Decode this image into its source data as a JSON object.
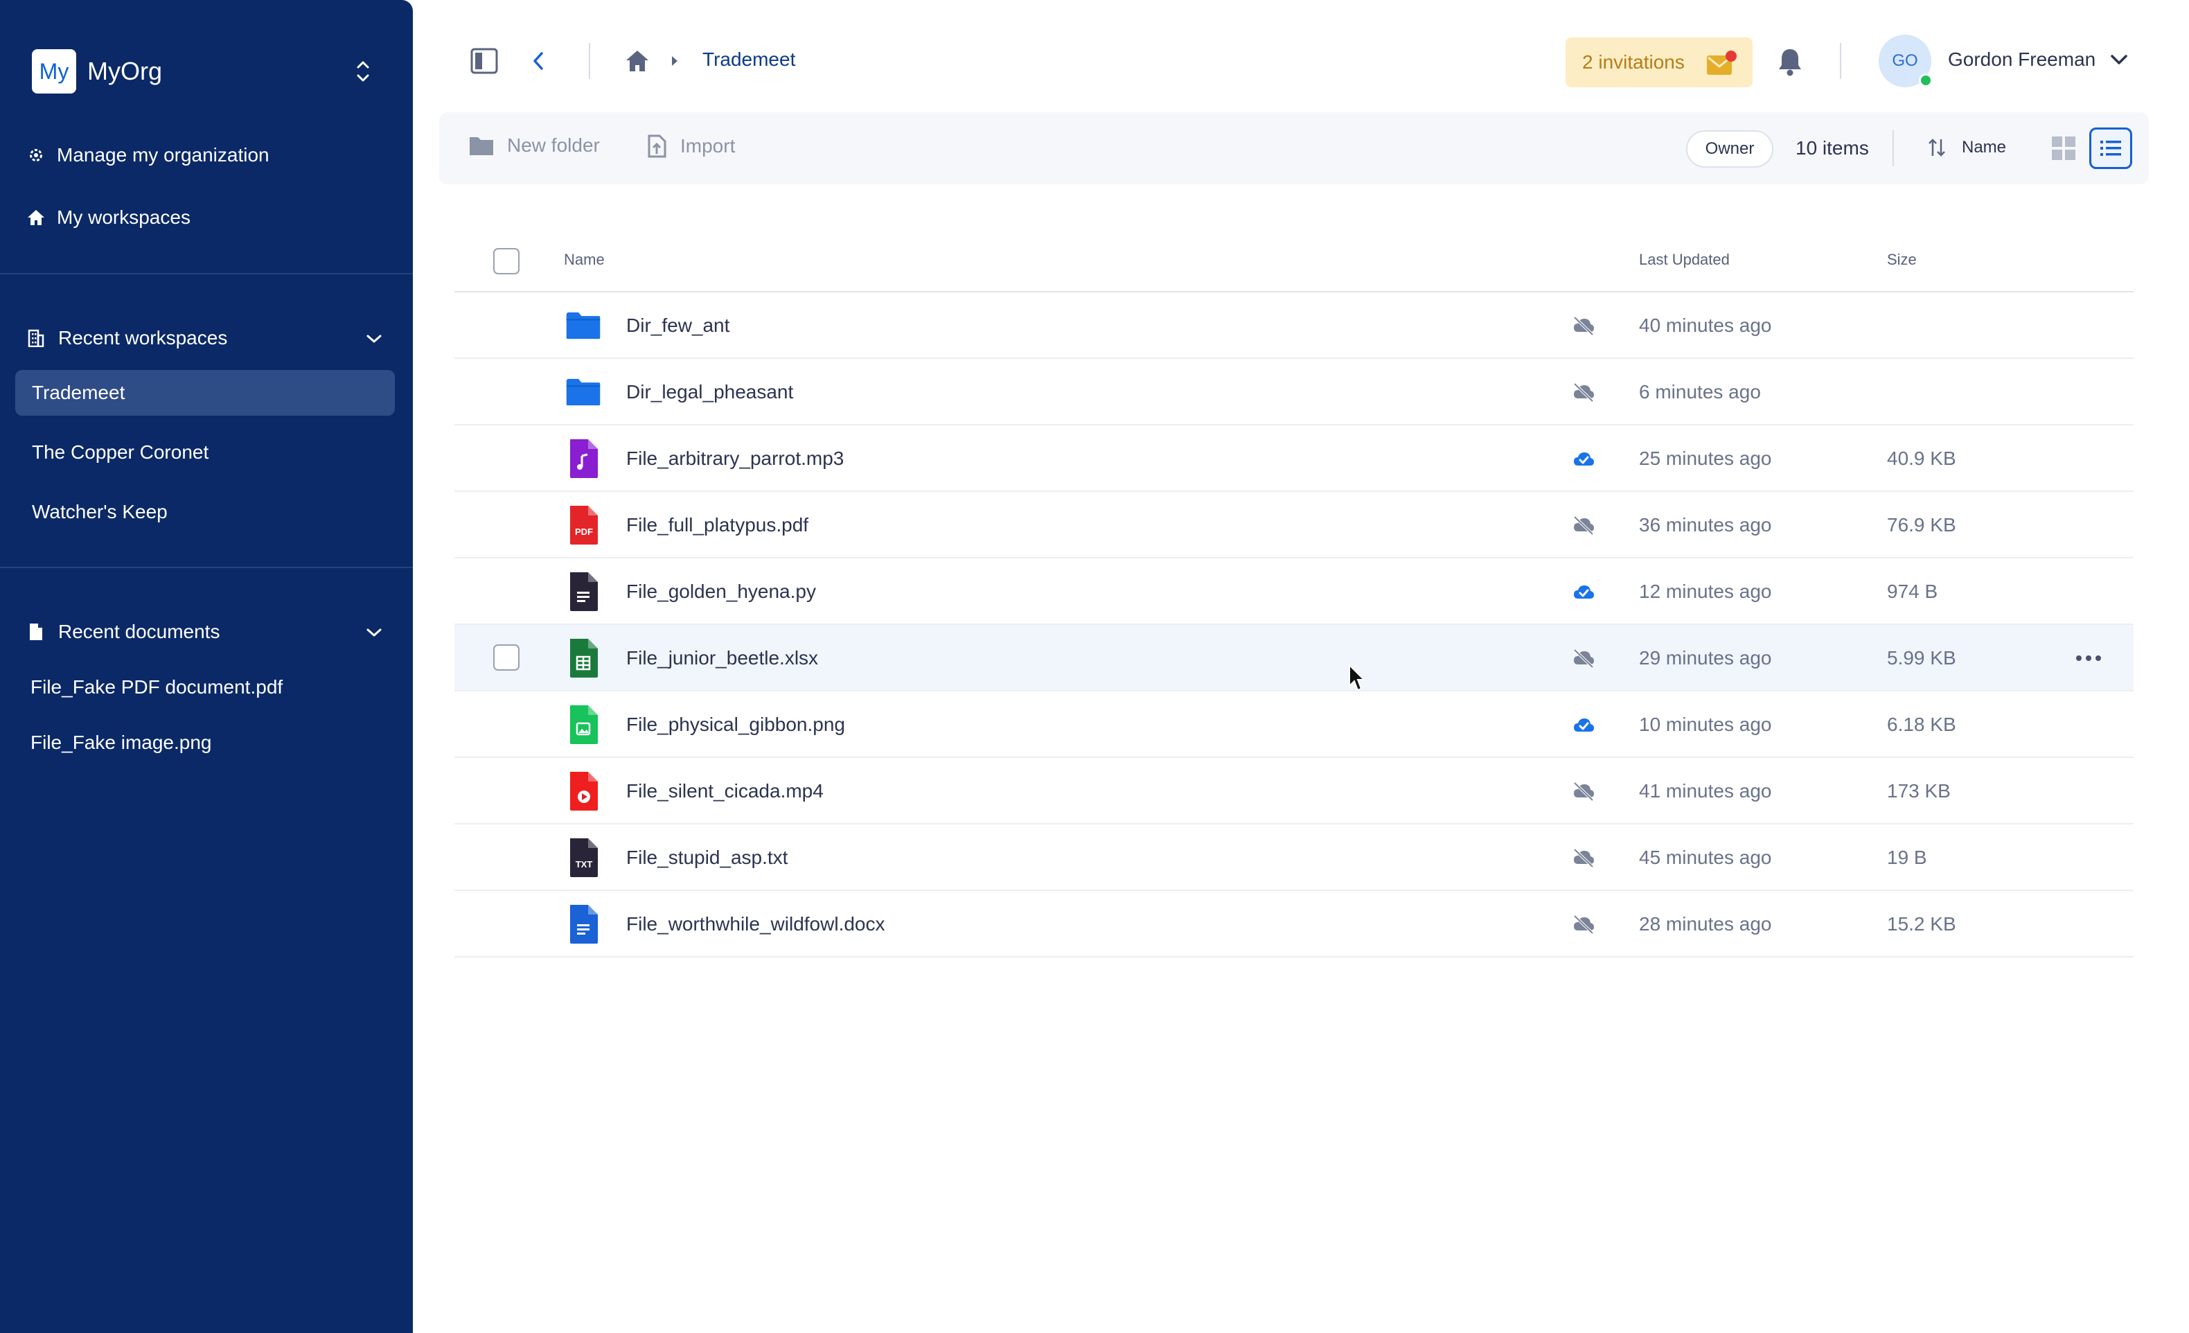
{
  "sidebar": {
    "org_logo": "My",
    "org_name": "MyOrg",
    "nav": [
      {
        "label": "Manage my organization",
        "icon": "gear-icon"
      },
      {
        "label": "My workspaces",
        "icon": "home-icon"
      }
    ],
    "recent_workspaces": {
      "title": "Recent workspaces",
      "items": [
        "Trademeet",
        "The Copper Coronet",
        "Watcher's Keep"
      ],
      "active": "Trademeet"
    },
    "recent_documents": {
      "title": "Recent documents",
      "items": [
        "File_Fake PDF document.pdf",
        "File_Fake image.png"
      ]
    }
  },
  "topbar": {
    "breadcrumb_current": "Trademeet",
    "invitations_label": "2 invitations",
    "user_initials": "GO",
    "user_name": "Gordon Freeman"
  },
  "toolbar": {
    "new_folder_label": "New folder",
    "import_label": "Import",
    "owner_label": "Owner",
    "items_count": "10 items",
    "sort_label": "Name"
  },
  "table": {
    "columns": {
      "name": "Name",
      "last_updated": "Last Updated",
      "size": "Size"
    },
    "rows": [
      {
        "name": "Dir_few_ant",
        "type": "folder",
        "synced": false,
        "updated": "40 minutes ago",
        "size": ""
      },
      {
        "name": "Dir_legal_pheasant",
        "type": "folder",
        "synced": false,
        "updated": "6 minutes ago",
        "size": ""
      },
      {
        "name": "File_arbitrary_parrot.mp3",
        "type": "audio",
        "synced": true,
        "updated": "25 minutes ago",
        "size": "40.9 KB"
      },
      {
        "name": "File_full_platypus.pdf",
        "type": "pdf",
        "synced": false,
        "updated": "36 minutes ago",
        "size": "76.9 KB"
      },
      {
        "name": "File_golden_hyena.py",
        "type": "code",
        "synced": true,
        "updated": "12 minutes ago",
        "size": "974 B"
      },
      {
        "name": "File_junior_beetle.xlsx",
        "type": "sheet",
        "synced": false,
        "updated": "29 minutes ago",
        "size": "5.99 KB"
      },
      {
        "name": "File_physical_gibbon.png",
        "type": "image",
        "synced": true,
        "updated": "10 minutes ago",
        "size": "6.18 KB"
      },
      {
        "name": "File_silent_cicada.mp4",
        "type": "video",
        "synced": false,
        "updated": "41 minutes ago",
        "size": "173 KB"
      },
      {
        "name": "File_stupid_asp.txt",
        "type": "text",
        "synced": false,
        "updated": "45 minutes ago",
        "size": "19 B"
      },
      {
        "name": "File_worthwhile_wildfowl.docx",
        "type": "doc",
        "synced": false,
        "updated": "28 minutes ago",
        "size": "15.2 KB"
      }
    ],
    "hovered_row": 5
  },
  "colors": {
    "sidebar_bg": "#0b2966",
    "accent": "#1660d3",
    "invitation_bg": "#fdedc4",
    "invitation_text": "#b47e18"
  }
}
